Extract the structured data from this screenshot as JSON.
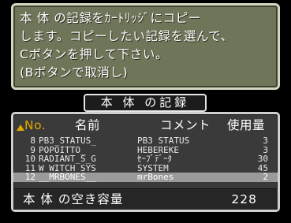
{
  "message": {
    "lines": [
      "本 体 の記録をｶｰﾄﾘｯｼﾞにコピー",
      "します。コピーしたい記録を選んで、",
      "Cボタンを押して下さい。",
      "(Bボタンで取消し)"
    ]
  },
  "list": {
    "title": "本 体 の記録",
    "headers": {
      "no": "No.",
      "name": "名前",
      "comment": "コメント",
      "usage": "使用量"
    },
    "rows": [
      {
        "no": "8",
        "name": "PB3_STATUS_",
        "comment": "PB3 STATUS",
        "usage": "3"
      },
      {
        "no": "9",
        "name": "POPOITTO_",
        "comment": "HEBEREKE",
        "usage": "3"
      },
      {
        "no": "10",
        "name": "RADIANT_S_G",
        "comment": "ｾｰﾌﾞﾃﾞｰﾀ",
        "usage": "30"
      },
      {
        "no": "11",
        "name": "W_WITCH_SYS",
        "comment": "SYSTEM____",
        "usage": "45"
      },
      {
        "no": "12",
        "name": "__MRBONES__",
        "comment": "mrBones",
        "usage": "2"
      }
    ],
    "free_label": "本 体 の空き容量",
    "free_value": "228"
  }
}
